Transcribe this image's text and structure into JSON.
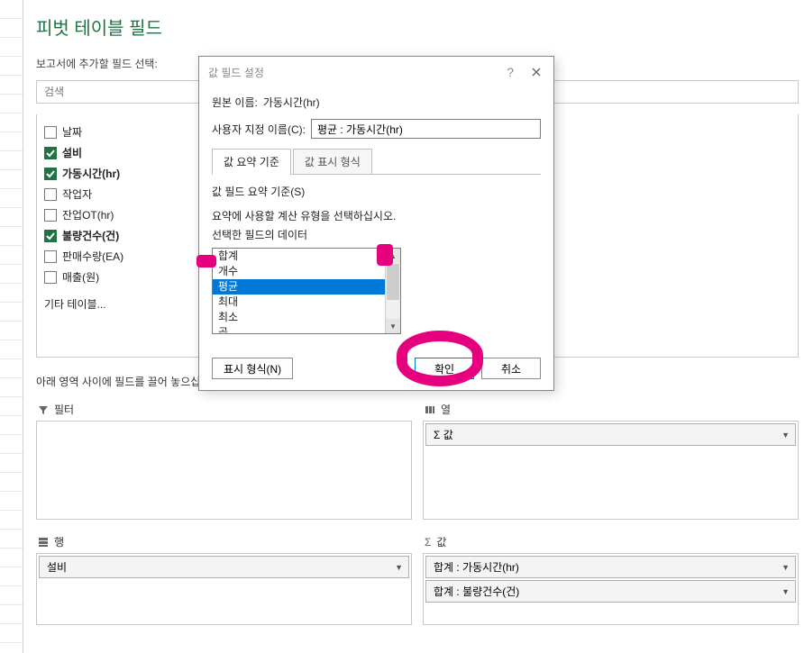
{
  "panel": {
    "title": "피벗 테이블 필드",
    "subtitle": "보고서에 추가할 필드 선택:",
    "search_placeholder": "검색",
    "more_tables": "기타 테이블..."
  },
  "fields": [
    {
      "label": "날짜",
      "checked": false,
      "bold": false
    },
    {
      "label": "설비",
      "checked": true,
      "bold": true
    },
    {
      "label": "가동시간(hr)",
      "checked": true,
      "bold": true
    },
    {
      "label": "작업자",
      "checked": false,
      "bold": false
    },
    {
      "label": "잔업OT(hr)",
      "checked": false,
      "bold": false
    },
    {
      "label": "불량건수(건)",
      "checked": true,
      "bold": true
    },
    {
      "label": "판매수량(EA)",
      "checked": false,
      "bold": false
    },
    {
      "label": "매출(원)",
      "checked": false,
      "bold": false
    }
  ],
  "drag": {
    "instruction": "아래 영역 사이에 필드를 끌어 놓으십시오.",
    "filters_label": "필터",
    "columns_label": "열",
    "rows_label": "행",
    "values_label": "값",
    "columns_items": [
      "Σ 값"
    ],
    "rows_items": [
      "설비"
    ],
    "values_items": [
      "합계 : 가동시간(hr)",
      "합계 : 불량건수(건)"
    ]
  },
  "dialog": {
    "title": "값 필드 설정",
    "source_label": "원본 이름:",
    "source_value": "가동시간(hr)",
    "custom_label": "사용자 지정 이름(C):",
    "custom_value": "평균 : 가동시간(hr)",
    "tab1": "값 요약 기준",
    "tab2": "값 표시 형식",
    "criteria_label": "값 필드 요약 기준(S)",
    "instruction1": "요약에 사용할 계산 유형을 선택하십시오.",
    "instruction2": "선택한 필드의 데이터",
    "options": [
      "합계",
      "개수",
      "평균",
      "최대",
      "최소",
      "곱"
    ],
    "selected_index": 2,
    "format_btn": "표시 형식(N)",
    "ok_btn": "확인",
    "cancel_btn": "취소"
  }
}
